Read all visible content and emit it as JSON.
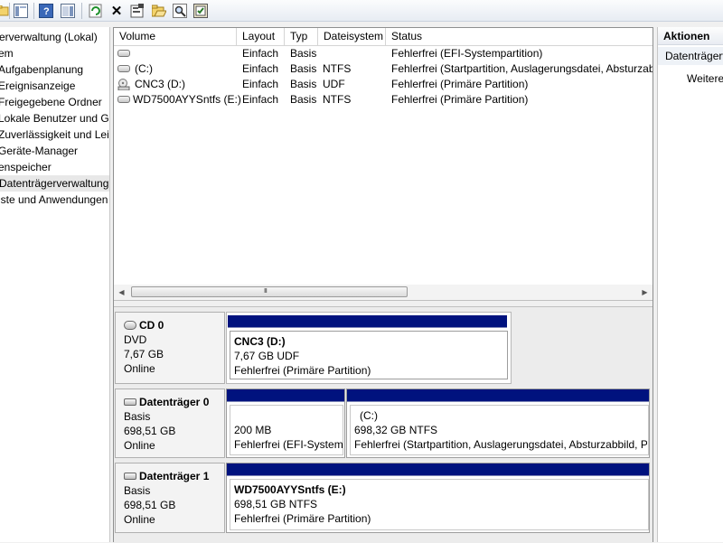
{
  "toolbar": {
    "buttons": [
      "folder-icon",
      "console-tree-icon",
      "help-icon",
      "properties-pane-icon",
      "refresh-icon",
      "delete-icon",
      "properties-icon",
      "open-icon",
      "search-icon",
      "settings-icon"
    ]
  },
  "tree": {
    "items": [
      {
        "label": "erverwaltung (Lokal)"
      },
      {
        "label": "em"
      },
      {
        "label": "Aufgabenplanung"
      },
      {
        "label": "Ereignisanzeige"
      },
      {
        "label": "Freigegebene Ordner"
      },
      {
        "label": "Lokale Benutzer und Gruppen"
      },
      {
        "label": "Zuverlässigkeit und Leistung"
      },
      {
        "label": "Geräte-Manager"
      },
      {
        "label": "enspeicher"
      },
      {
        "label": "Datenträgerverwaltung",
        "selected": true
      },
      {
        "label": "iste und Anwendungen"
      }
    ]
  },
  "volume_list": {
    "columns": [
      "Volume",
      "Layout",
      "Typ",
      "Dateisystem",
      "Status"
    ],
    "rows": [
      {
        "volume": "",
        "layout": "Einfach",
        "typ": "Basis",
        "fs": "",
        "status": "Fehlerfrei (EFI-Systempartition)",
        "icon": "drive-icon"
      },
      {
        "volume": "(C:)",
        "layout": "Einfach",
        "typ": "Basis",
        "fs": "NTFS",
        "status": "Fehlerfrei (Startpartition, Auslagerungsdatei, Absturzab",
        "icon": "drive-icon"
      },
      {
        "volume": "CNC3 (D:)",
        "layout": "Einfach",
        "typ": "Basis",
        "fs": "UDF",
        "status": "Fehlerfrei (Primäre Partition)",
        "icon": "cd-drive-icon"
      },
      {
        "volume": "WD7500AYYSntfs (E:)",
        "layout": "Einfach",
        "typ": "Basis",
        "fs": "NTFS",
        "status": "Fehlerfrei (Primäre Partition)",
        "icon": "drive-icon"
      }
    ],
    "scroll_grip": "III"
  },
  "disks": {
    "cd0": {
      "name": "CD 0",
      "type": "DVD",
      "size": "7,67 GB",
      "state": "Online",
      "partition": {
        "name": "CNC3  (D:)",
        "size": "7,67 GB UDF",
        "status": "Fehlerfrei (Primäre Partition)"
      }
    },
    "disk0": {
      "name": "Datenträger 0",
      "type": "Basis",
      "size": "698,51 GB",
      "state": "Online",
      "partitions": [
        {
          "name": "",
          "size": "200 MB",
          "status": "Fehlerfrei (EFI-Systempartition)"
        },
        {
          "name": "(C:)",
          "size": "698,32 GB NTFS",
          "status": "Fehlerfrei (Startpartition, Auslagerungsdatei, Absturzabbild, P"
        }
      ]
    },
    "disk1": {
      "name": "Datenträger 1",
      "type": "Basis",
      "size": "698,51 GB",
      "state": "Online",
      "partition": {
        "name": "WD7500AYYSntfs  (E:)",
        "size": "698,51 GB NTFS",
        "status": "Fehlerfrei (Primäre Partition)"
      }
    }
  },
  "actions": {
    "title": "Aktionen",
    "section": "Datenträgerverwaltung",
    "item": "Weitere Aktionen"
  },
  "colors": {
    "partition_bar": "#00127e"
  }
}
